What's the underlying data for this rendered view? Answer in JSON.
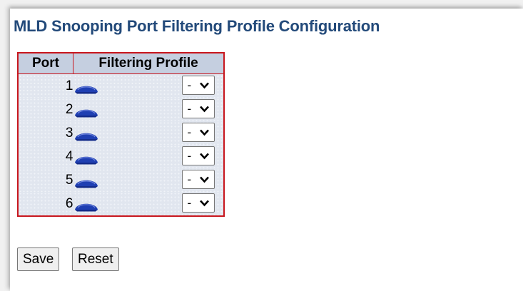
{
  "page": {
    "title": "MLD Snooping Port Filtering Profile Configuration"
  },
  "table": {
    "headers": {
      "port": "Port",
      "filtering_profile": "Filtering Profile"
    },
    "rows": [
      {
        "port": "1",
        "profile": "-"
      },
      {
        "port": "2",
        "profile": "-"
      },
      {
        "port": "3",
        "profile": "-"
      },
      {
        "port": "4",
        "profile": "-"
      },
      {
        "port": "5",
        "profile": "-"
      },
      {
        "port": "6",
        "profile": "-"
      }
    ],
    "icon": "view-profile-icon"
  },
  "buttons": {
    "save": "Save",
    "reset": "Reset"
  },
  "colors": {
    "title": "#234a7a",
    "table_border": "#c8161d",
    "header_bg": "#c5cfe0",
    "row_bg": "#e1e6ef",
    "icon": "#1f3fb2"
  }
}
